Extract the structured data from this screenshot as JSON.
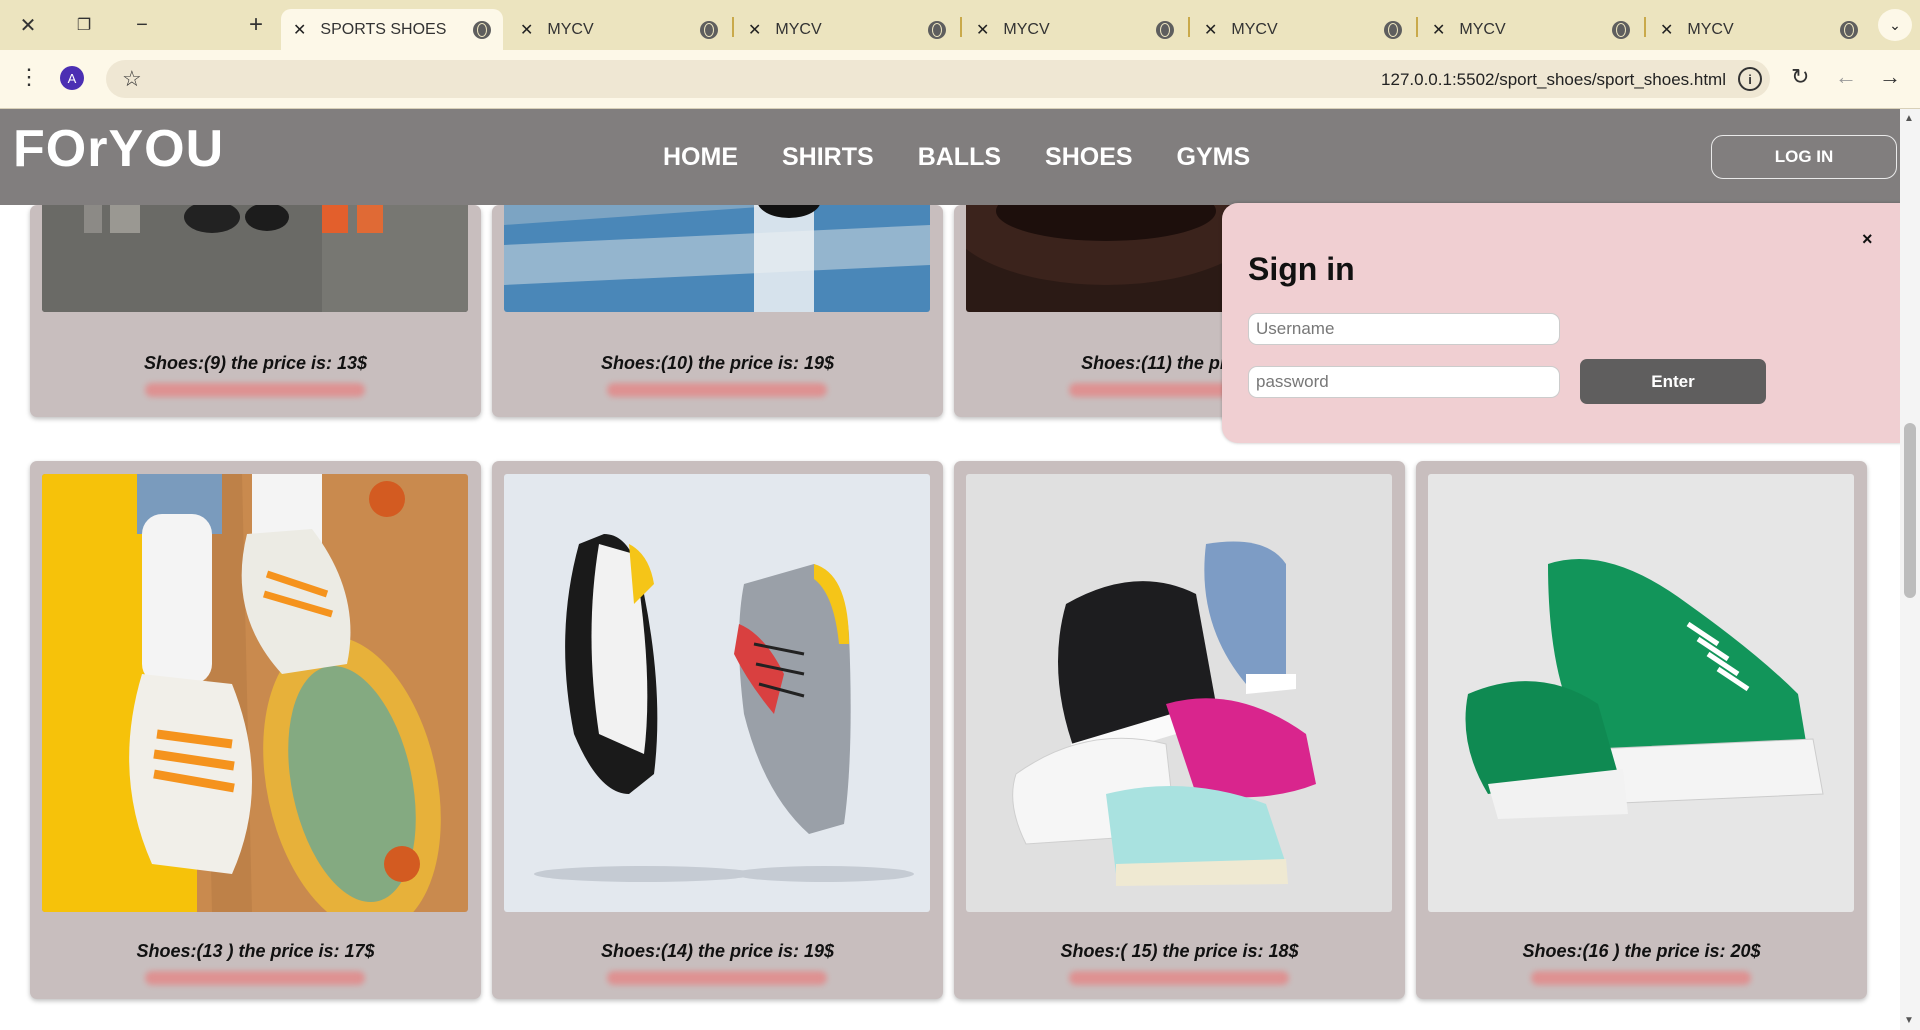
{
  "browser": {
    "tabs": [
      {
        "title": "SPORTS SHOES",
        "active": true
      },
      {
        "title": "MYCV",
        "active": false
      },
      {
        "title": "MYCV",
        "active": false
      },
      {
        "title": "MYCV",
        "active": false
      },
      {
        "title": "MYCV",
        "active": false
      },
      {
        "title": "MYCV",
        "active": false
      },
      {
        "title": "MYCV",
        "active": false
      }
    ],
    "profile_initial": "A",
    "url": "127.0.0.1:5502/sport_shoes/sport_shoes.html"
  },
  "site": {
    "logo": "FOrYOU",
    "nav": [
      "HOME",
      "SHIRTS",
      "BALLS",
      "SHOES",
      "GYMS"
    ],
    "login_label": "LOG IN"
  },
  "products": [
    {
      "caption": "Shoes:(9) the price is: 13$"
    },
    {
      "caption": "Shoes:(10) the price is: 19$"
    },
    {
      "caption": "Shoes:(11) the price is: "
    },
    {
      "caption": ""
    },
    {
      "caption": "Shoes:(13 ) the price is: 17$"
    },
    {
      "caption": "Shoes:(14) the price is: 19$"
    },
    {
      "caption": "Shoes:( 15) the price is: 18$"
    },
    {
      "caption": "Shoes:(16 ) the price is: 20$"
    }
  ],
  "signin": {
    "title": "Sign in",
    "close": "×",
    "username_placeholder": "Username",
    "password_placeholder": "password",
    "enter_label": "Enter"
  },
  "colors": {
    "tabbar": "#ece4bf",
    "nav_bg": "#817e7e",
    "card_bg": "#c8bebe",
    "signin_bg": "#f0cfd2",
    "enter_bg": "#5f5e5e"
  }
}
